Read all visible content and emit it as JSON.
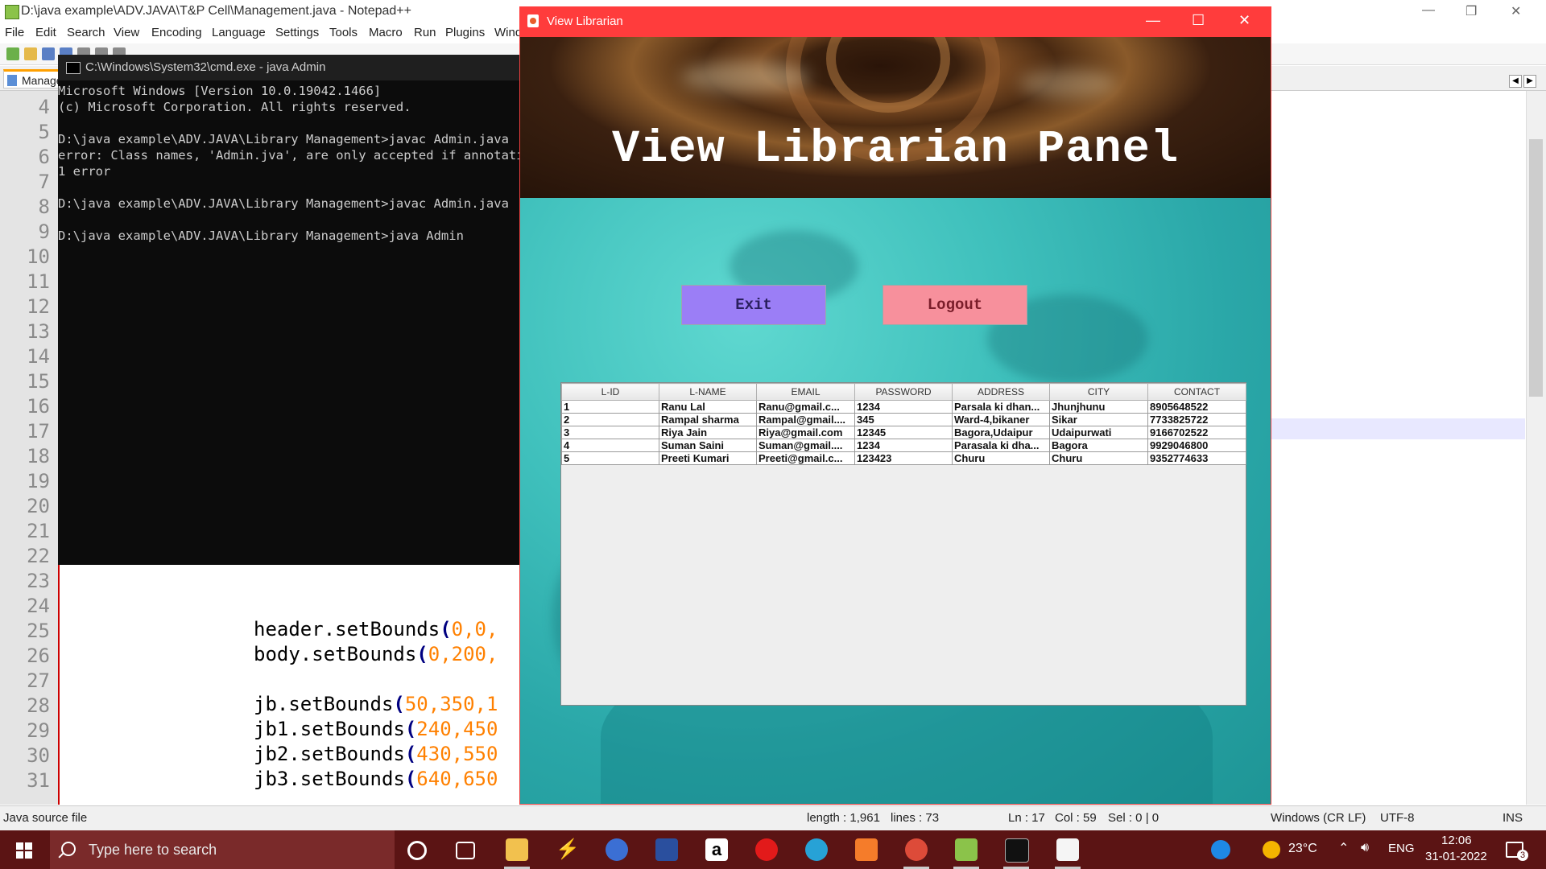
{
  "notepad": {
    "title": "D:\\java example\\ADV.JAVA\\T&P Cell\\Management.java - Notepad++",
    "menu": [
      "File",
      "Edit",
      "Search",
      "View",
      "Encoding",
      "Language",
      "Settings",
      "Tools",
      "Macro",
      "Run",
      "Plugins",
      "Wind"
    ],
    "tab_label": "Manage",
    "line_numbers": [
      "4",
      "5",
      "6",
      "7",
      "8",
      "9",
      "10",
      "11",
      "12",
      "13",
      "14",
      "15",
      "16",
      "17",
      "18",
      "19",
      "20",
      "21",
      "22",
      "23",
      "24",
      "25",
      "26",
      "27",
      "28",
      "29",
      "30",
      "31"
    ],
    "code": [
      {
        "obj": "header.setBounds",
        "args": "0,0,"
      },
      {
        "obj": "body.setBounds",
        "args": "0,200,"
      },
      {
        "obj": "jb.setBounds",
        "args": "50,350,1"
      },
      {
        "obj": "jb1.setBounds",
        "args": "240,450"
      },
      {
        "obj": "jb2.setBounds",
        "args": "430,550"
      },
      {
        "obj": "jb3.setBounds",
        "args": "640,650"
      }
    ],
    "status": {
      "file_type": "Java source file",
      "length": "length : 1,961",
      "lines": "lines : 73",
      "ln": "Ln : 17",
      "col": "Col : 59",
      "sel": "Sel : 0 | 0",
      "eol": "Windows (CR LF)",
      "encoding": "UTF-8",
      "mode": "INS"
    }
  },
  "cmd": {
    "title": "C:\\Windows\\System32\\cmd.exe - java  Admin",
    "lines": [
      "Microsoft Windows [Version 10.0.19042.1466]",
      "(c) Microsoft Corporation. All rights reserved.",
      "",
      "D:\\java example\\ADV.JAVA\\Library Management>javac Admin.java",
      "error: Class names, 'Admin.jva', are only accepted if annotation",
      "1 error",
      "",
      "D:\\java example\\ADV.JAVA\\Library Management>javac Admin.java",
      "",
      "D:\\java example\\ADV.JAVA\\Library Management>java Admin"
    ]
  },
  "java_window": {
    "title": "View Librarian",
    "heading": "View Librarian Panel",
    "exit_label": "Exit",
    "logout_label": "Logout",
    "table": {
      "columns": [
        "L-ID",
        "L-NAME",
        "EMAIL",
        "PASSWORD",
        "ADDRESS",
        "CITY",
        "CONTACT"
      ],
      "rows": [
        [
          "1",
          "Ranu Lal",
          "Ranu@gmail.c...",
          "1234",
          "Parsala ki dhan...",
          "Jhunjhunu",
          "8905648522"
        ],
        [
          "2",
          "Rampal sharma",
          "Rampal@gmail....",
          "345",
          "Ward-4,bikaner",
          "Sikar",
          "7733825722"
        ],
        [
          "3",
          "Riya Jain",
          "Riya@gmail.com",
          "12345",
          "Bagora,Udaipur",
          "Udaipurwati",
          "9166702522"
        ],
        [
          "4",
          "Suman Saini",
          "Suman@gmail....",
          "1234",
          "Parasala ki dha...",
          "Bagora",
          "9929046800"
        ],
        [
          "5",
          "Preeti Kumari",
          "Preeti@gmail.c...",
          "123423",
          "Churu",
          "Churu",
          "9352774633"
        ]
      ]
    }
  },
  "taskbar": {
    "search_placeholder": "Type here to search",
    "temperature": "23°C",
    "language": "ENG",
    "time": "12:06",
    "date": "31-01-2022",
    "notification_count": "3"
  }
}
